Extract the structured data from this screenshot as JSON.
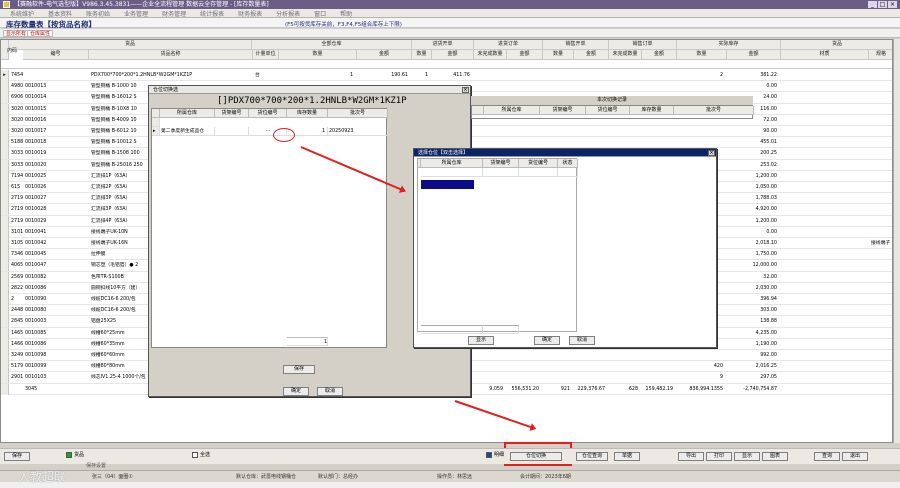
{
  "window": {
    "title": "【赛融软件-电气选型版】V986.3.45.3831——企业全流程管理 数据云全存管理 - [库存数量表]"
  },
  "menu": [
    "系统维护",
    "基本资料",
    "账务初始",
    "业务管理",
    "财务管理",
    "统计报表",
    "财务报表",
    "分析报表",
    "窗口",
    "帮助"
  ],
  "page": {
    "title": "库存数量表【按货品名称】",
    "hint": "(F5可按货库存关前，F3,F4,F5组合库存上下限)"
  },
  "tabs": [
    "显示所有",
    "仓库属性"
  ],
  "grid": {
    "groups": [
      "货品",
      "全部仓库",
      "进货开单",
      "进货订单",
      "销售开单",
      "销售订单",
      "实际库存",
      "货品"
    ],
    "columns": [
      "内码",
      "编号",
      "货品名称",
      "计量单位",
      "数量",
      "金额",
      "数量",
      "金额",
      "未完成数量",
      "金额",
      "数量",
      "金额",
      "未完成数量",
      "金额",
      "数量",
      "金额",
      "材质",
      "规格"
    ],
    "rows": [
      {
        "id": "74542",
        "code": "",
        "name": "PDX700*700*200*1.2HNLB*W2GM*1KZ1P",
        "unit": "台",
        "qty": "1",
        "amt": "190.61",
        "q2": "1",
        "a2": "411.76",
        "q3": "",
        "a3": "",
        "q4": "",
        "a4": "",
        "q5": "",
        "a5": "",
        "q6": "2",
        "a6": "381.22",
        "mat": "",
        "spec": ""
      },
      {
        "id": "49803",
        "code": "0010013",
        "name": "管型铜桶 B-1000 10",
        "unit": "",
        "qty": "",
        "amt": "",
        "q2": "",
        "a2": "",
        "q3": "",
        "a3": "",
        "q4": "",
        "a4": "",
        "q5": "",
        "a5": "",
        "q6": "",
        "a6": "0.00",
        "mat": "",
        "spec": ""
      },
      {
        "id": "69064",
        "code": "0010014",
        "name": "管型铜桶 B-16012 S",
        "unit": "",
        "qty": "",
        "amt": "",
        "q2": "",
        "a2": "",
        "q3": "",
        "a3": "",
        "q4": "",
        "a4": "",
        "q5": "",
        "a5": "",
        "q6": "",
        "a6": "24.00",
        "mat": "",
        "spec": ""
      },
      {
        "id": "30205",
        "code": "0010015",
        "name": "管型铜桶 B-10X8 10",
        "unit": "",
        "qty": "",
        "amt": "",
        "q2": "",
        "a2": "",
        "q3": "",
        "a3": "",
        "q4": "",
        "a4": "",
        "q5": "",
        "a5": "",
        "q6": "",
        "a6": "116.00",
        "mat": "",
        "spec": ""
      },
      {
        "id": "30206",
        "code": "0010016",
        "name": "管型铜桶 B-4009 10",
        "unit": "",
        "qty": "",
        "amt": "",
        "q2": "",
        "a2": "",
        "q3": "",
        "a3": "",
        "q4": "",
        "a4": "",
        "q5": "",
        "a5": "",
        "q6": "",
        "a6": "72.00",
        "mat": "",
        "spec": ""
      },
      {
        "id": "30207",
        "code": "0010017",
        "name": "管型铜桶 B-6012 10",
        "unit": "",
        "qty": "",
        "amt": "",
        "q2": "",
        "a2": "",
        "q3": "",
        "a3": "",
        "q4": "",
        "a4": "",
        "q5": "",
        "a5": "",
        "q6": "",
        "a6": "90.00",
        "mat": "",
        "spec": ""
      },
      {
        "id": "51886",
        "code": "0010018",
        "name": "管型铜桶 B-10012 S",
        "unit": "",
        "qty": "",
        "amt": "",
        "q2": "",
        "a2": "",
        "q3": "",
        "a3": "",
        "q4": "",
        "a4": "",
        "q5": "",
        "a5": "",
        "q6": "",
        "a6": "455.01",
        "mat": "",
        "spec": ""
      },
      {
        "id": "30334",
        "code": "0010019",
        "name": "管型铜桶 B-1508 100",
        "unit": "",
        "qty": "",
        "amt": "",
        "q2": "",
        "a2": "",
        "q3": "",
        "a3": "",
        "q4": "",
        "a4": "",
        "q5": "",
        "a5": "",
        "q6": "",
        "a6": "200.25",
        "mat": "",
        "spec": ""
      },
      {
        "id": "30335",
        "code": "0010020",
        "name": "管型铜桶 B-25016 250",
        "unit": "",
        "qty": "",
        "amt": "",
        "q2": "",
        "a2": "",
        "q3": "",
        "a3": "",
        "q4": "",
        "a4": "",
        "q5": "",
        "a5": "",
        "q6": "",
        "a6": "253.02",
        "mat": "",
        "spec": ""
      },
      {
        "id": "71940",
        "code": "0010025",
        "name": "汇流排1P（63A）",
        "unit": "",
        "qty": "",
        "amt": "",
        "q2": "",
        "a2": "",
        "q3": "",
        "a3": "",
        "q4": "",
        "a4": "",
        "q5": "",
        "a5": "",
        "q6": "",
        "a6": "1,200.00",
        "mat": "",
        "spec": ""
      },
      {
        "id": "615",
        "code": "0010026",
        "name": "汇流排2P（63A）",
        "unit": "",
        "qty": "",
        "amt": "",
        "q2": "",
        "a2": "",
        "q3": "",
        "a3": "",
        "q4": "",
        "a4": "",
        "q5": "",
        "a5": "",
        "q6": "",
        "a6": "1,050.00",
        "mat": "",
        "spec": ""
      },
      {
        "id": "27190",
        "code": "0010027",
        "name": "汇流排3P（63A）",
        "unit": "",
        "qty": "",
        "amt": "",
        "q2": "",
        "a2": "",
        "q3": "",
        "a3": "",
        "q4": "",
        "a4": "",
        "q5": "",
        "a5": "",
        "q6": "",
        "a6": "1,788.03",
        "mat": "",
        "spec": ""
      },
      {
        "id": "27192",
        "code": "0010028",
        "name": "汇流排3P（63A）",
        "unit": "",
        "qty": "",
        "amt": "",
        "q2": "",
        "a2": "",
        "q3": "",
        "a3": "",
        "q4": "",
        "a4": "",
        "q5": "",
        "a5": "",
        "q6": "",
        "a6": "4,920.00",
        "mat": "",
        "spec": ""
      },
      {
        "id": "27193",
        "code": "0010029",
        "name": "汇流排4P（63A）",
        "unit": "",
        "qty": "",
        "amt": "",
        "q2": "",
        "a2": "",
        "q3": "",
        "a3": "",
        "q4": "",
        "a4": "",
        "q5": "",
        "a5": "",
        "q6": "",
        "a6": "1,200.00",
        "mat": "",
        "spec": ""
      },
      {
        "id": "31010",
        "code": "0010041",
        "name": "接线端子UK-10N",
        "unit": "",
        "qty": "",
        "amt": "",
        "q2": "",
        "a2": "",
        "q3": "",
        "a3": "",
        "q4": "",
        "a4": "",
        "q5": "",
        "a5": "",
        "q6": "",
        "a6": "0.00",
        "mat": "",
        "spec": ""
      },
      {
        "id": "31050",
        "code": "0010042",
        "name": "接线端子UK-16N",
        "unit": "",
        "qty": "",
        "amt": "",
        "q2": "",
        "a2": "",
        "q3": "",
        "a3": "",
        "q4": "",
        "a4": "",
        "q5": "",
        "a5": "",
        "q6": "",
        "a6": "2,018.10",
        "mat": "",
        "spec": "接线端子"
      },
      {
        "id": "7346",
        "code": "0010045",
        "name": "拉伸膜",
        "unit": "",
        "qty": "",
        "amt": "",
        "q2": "",
        "a2": "",
        "q3": "",
        "a3": "",
        "q4": "",
        "a4": "",
        "q5": "",
        "a5": "",
        "q6": "",
        "a6": "1,750.00",
        "mat": "",
        "spec": ""
      },
      {
        "id": "40655",
        "code": "0010047",
        "name": "铜芯塑（毛铝箔）● 2",
        "unit": "",
        "qty": "",
        "amt": "",
        "q2": "",
        "a2": "",
        "q3": "",
        "a3": "",
        "q4": "",
        "a4": "",
        "q5": "",
        "a5": "",
        "q6": "",
        "a6": "12,000.00",
        "mat": "",
        "spec": ""
      },
      {
        "id": "25693",
        "code": "0010082",
        "name": "色带TR-S100B",
        "unit": "",
        "qty": "",
        "amt": "",
        "q2": "",
        "a2": "",
        "q3": "",
        "a3": "",
        "q4": "",
        "a4": "",
        "q5": "",
        "a5": "",
        "q6": "",
        "a6": "32.00",
        "mat": "",
        "spec": ""
      },
      {
        "id": "28225",
        "code": "0010086",
        "name": "圆铜扣线10平方（建）",
        "unit": "",
        "qty": "",
        "amt": "",
        "q2": "",
        "a2": "",
        "q3": "",
        "a3": "",
        "q4": "",
        "a4": "",
        "q5": "",
        "a5": "",
        "q6": "",
        "a6": "2,030.00",
        "mat": "",
        "spec": ""
      },
      {
        "id": "2",
        "code": "0010090",
        "name": "线缆DC16-6 200/包",
        "unit": "",
        "qty": "",
        "amt": "",
        "q2": "",
        "a2": "",
        "q3": "",
        "a3": "",
        "q4": "",
        "a4": "",
        "q5": "",
        "a5": "",
        "q6": "",
        "a6": "396.94",
        "mat": "",
        "spec": ""
      },
      {
        "id": "2448",
        "code": "0010080",
        "name": "线缆DC16-6 200/包",
        "unit": "",
        "qty": "",
        "amt": "",
        "q2": "",
        "a2": "",
        "q3": "",
        "a3": "",
        "q4": "",
        "a4": "",
        "q5": "",
        "a5": "",
        "q6": "",
        "a6": "303.00",
        "mat": "",
        "spec": ""
      },
      {
        "id": "28458",
        "code": "0010003",
        "name": "铝盘25X25",
        "unit": "",
        "qty": "",
        "amt": "",
        "q2": "",
        "a2": "",
        "q3": "",
        "a3": "",
        "q4": "",
        "a4": "",
        "q5": "",
        "a5": "",
        "q6": "",
        "a6": "138.88",
        "mat": "",
        "spec": ""
      },
      {
        "id": "14659",
        "code": "0010085",
        "name": "线槽60*25mm",
        "unit": "",
        "qty": "",
        "amt": "",
        "q2": "",
        "a2": "",
        "q3": "",
        "a3": "",
        "q4": "",
        "a4": "",
        "q5": "",
        "a5": "",
        "q6": "",
        "a6": "4,235.00",
        "mat": "",
        "spec": ""
      },
      {
        "id": "14660",
        "code": "0010086",
        "name": "线槽60*35mm",
        "unit": "",
        "qty": "",
        "amt": "",
        "q2": "",
        "a2": "",
        "q3": "",
        "a3": "",
        "q4": "",
        "a4": "",
        "q5": "",
        "a5": "",
        "q6": "",
        "a6": "1,190.00",
        "mat": "",
        "spec": ""
      },
      {
        "id": "3249",
        "code": "0010098",
        "name": "线槽60*60mm",
        "unit": "",
        "qty": "",
        "amt": "",
        "q2": "",
        "a2": "",
        "q3": "",
        "a3": "",
        "q4": "",
        "a4": "",
        "q5": "",
        "a5": "",
        "q6": "",
        "a6": "992.00",
        "mat": "",
        "spec": ""
      },
      {
        "id": "51796",
        "code": "0010099",
        "name": "线槽80*80mm",
        "unit": "米",
        "qty": "420",
        "amt": "2,016.25",
        "q2": "",
        "a2": "",
        "q3": "",
        "a3": "",
        "q4": "",
        "a4": "",
        "q5": "",
        "a5": "",
        "q6": "420",
        "a6": "2,016.25",
        "mat": "",
        "spec": ""
      },
      {
        "id": "29010",
        "code": "0010103",
        "name": "线芯IV1.25-4 1000个/包",
        "unit": "包",
        "qty": "9",
        "amt": "297.05",
        "q2": "",
        "a2": "",
        "q3": "",
        "a3": "",
        "q4": "",
        "a4": "",
        "q5": "",
        "a5": "",
        "q6": "9",
        "a6": "297.05",
        "mat": "",
        "spec": ""
      },
      {
        "id": "",
        "code": "3045",
        "name": "",
        "unit": "",
        "qty": "865,517.906",
        "amt": "10,122,170.33",
        "q2": "1,161",
        "a2": "174,697.31",
        "q3": "9,059",
        "a3": "556,531.20",
        "q4": "921",
        "a4": "229,376.67",
        "q5": "628",
        "a5": "159,482.19",
        "q6": "836,994.1355",
        "a6": "-2,740,754.87",
        "mat": "",
        "spec": ""
      }
    ]
  },
  "dlg_location": {
    "title": "仓位切换选",
    "product_title": "[]PDX700*700*200*1.2HNLB*W2GM*1KZ1P",
    "headers": [
      "所属仓库",
      "货架编号",
      "货位编号",
      "库存数量",
      "批次号"
    ],
    "row": {
      "warehouse": "第二季度新生成品仓",
      "shelf": "",
      "location": "",
      "qty": "1",
      "batch": "20250923"
    },
    "footer_qty": "1",
    "save": "保存",
    "ok": "确定",
    "cancel": "取消"
  },
  "dlg_history": {
    "title": "本次切换记录",
    "headers": [
      "所属仓库",
      "货架编号",
      "货位编号",
      "库存数量",
      "批次号"
    ]
  },
  "dlg_select": {
    "title": "选择仓位【双击选择】",
    "headers": [
      "所属仓库",
      "货架编号",
      "货位编号",
      "状态"
    ],
    "show": "显示",
    "ok": "确定",
    "cancel": "取消"
  },
  "bottom": {
    "save": "保存",
    "goods_label": "货品",
    "all_select": "全选",
    "detail": "明细",
    "switch": "仓位切换",
    "query": "仓位查询",
    "single": "单据",
    "export": "导出",
    "print": "打印",
    "show": "显示",
    "chart": "图表",
    "search": "查询",
    "exit": "退出",
    "save_setting": "保存设置"
  },
  "status": {
    "user": "张三（04）面圈①",
    "warehouse": "默认仓库：武蔷电线钢桶仓",
    "dept": "默认部门：总经办",
    "operator": "操作员：林思远",
    "period": "会计期间：2023年6期"
  },
  "watermark": "人教超联",
  "colors": {
    "accent": "#e02020",
    "title": "#1a2a78",
    "select": "#0a0a8a"
  }
}
